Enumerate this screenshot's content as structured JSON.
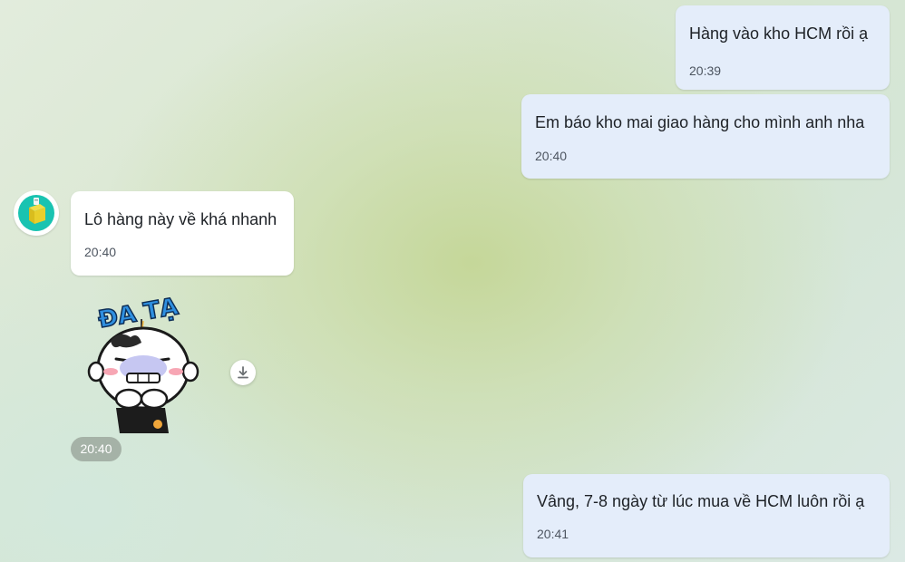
{
  "messages": [
    {
      "direction": "out",
      "text": "Hàng vào kho HCM rồi ạ",
      "time": "20:39"
    },
    {
      "direction": "out",
      "text": "Em báo kho mai giao hàng cho mình anh nha",
      "time": "20:40"
    },
    {
      "direction": "in",
      "text": "Lô hàng này về khá nhanh",
      "time": "20:40"
    },
    {
      "direction": "out",
      "text": "Vâng, 7-8 ngày từ lúc mua về HCM luôn rồi ạ",
      "time": "20:41"
    }
  ],
  "sticker": {
    "caption": "ĐA TẠ",
    "time": "20:40"
  },
  "icons": {
    "avatar": "yellow-box-avatar-icon",
    "download": "download-icon"
  },
  "colors": {
    "outgoing_bubble": "#e4edfa",
    "incoming_bubble": "#ffffff",
    "avatar_bg": "#19c3b1",
    "sticker_text": "#2f8fe0"
  }
}
